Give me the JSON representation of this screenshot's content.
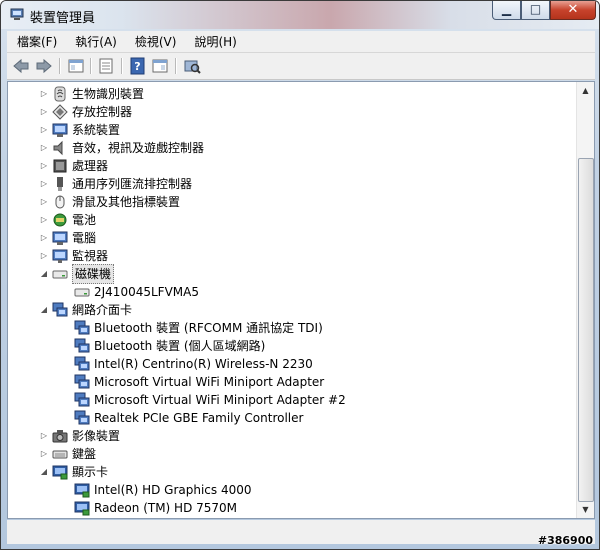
{
  "window": {
    "title": "裝置管理員"
  },
  "caption_buttons": {
    "minimize": "▁",
    "maximize": "□",
    "close": "✕"
  },
  "menu": [
    "檔案(F)",
    "執行(A)",
    "檢視(V)",
    "說明(H)"
  ],
  "toolbar": [
    "back-icon",
    "forward-icon",
    "properties-view-icon",
    "details-icon",
    "help-icon",
    "window-icon",
    "scan-hardware-icon"
  ],
  "tree": [
    {
      "label": "生物識別裝置",
      "icon": "fingerprint-icon",
      "expander": "▷",
      "level": 0
    },
    {
      "label": "存放控制器",
      "icon": "storage-controller-icon",
      "expander": "▷",
      "level": 0
    },
    {
      "label": "系統裝置",
      "icon": "computer-icon",
      "expander": "▷",
      "level": 0
    },
    {
      "label": "音效，視訊及遊戲控制器",
      "icon": "speaker-icon",
      "expander": "▷",
      "level": 0
    },
    {
      "label": "處理器",
      "icon": "processor-icon",
      "expander": "▷",
      "level": 0
    },
    {
      "label": "通用序列匯流排控制器",
      "icon": "usb-icon",
      "expander": "▷",
      "level": 0
    },
    {
      "label": "滑鼠及其他指標裝置",
      "icon": "mouse-icon",
      "expander": "▷",
      "level": 0
    },
    {
      "label": "電池",
      "icon": "battery-icon",
      "expander": "▷",
      "level": 0
    },
    {
      "label": "電腦",
      "icon": "computer-icon",
      "expander": "▷",
      "level": 0
    },
    {
      "label": "監視器",
      "icon": "monitor-icon",
      "expander": "▷",
      "level": 0
    },
    {
      "label": "磁碟機",
      "icon": "disk-drive-icon",
      "expander": "◢",
      "level": 0,
      "selected": true
    },
    {
      "label": "2J410045LFVMA5",
      "icon": "disk-drive-icon",
      "expander": "",
      "level": 1
    },
    {
      "label": "網路介面卡",
      "icon": "network-adapter-icon",
      "expander": "◢",
      "level": 0
    },
    {
      "label": "Bluetooth 裝置 (RFCOMM 通訊協定 TDI)",
      "icon": "network-adapter-icon",
      "expander": "",
      "level": 1
    },
    {
      "label": "Bluetooth 裝置 (個人區域網路)",
      "icon": "network-adapter-icon",
      "expander": "",
      "level": 1
    },
    {
      "label": "Intel(R) Centrino(R) Wireless-N 2230",
      "icon": "network-adapter-icon",
      "expander": "",
      "level": 1
    },
    {
      "label": "Microsoft Virtual WiFi Miniport Adapter",
      "icon": "network-adapter-icon",
      "expander": "",
      "level": 1
    },
    {
      "label": "Microsoft Virtual WiFi Miniport Adapter #2",
      "icon": "network-adapter-icon",
      "expander": "",
      "level": 1
    },
    {
      "label": "Realtek PCIe GBE Family Controller",
      "icon": "network-adapter-icon",
      "expander": "",
      "level": 1
    },
    {
      "label": "影像裝置",
      "icon": "camera-icon",
      "expander": "▷",
      "level": 0
    },
    {
      "label": "鍵盤",
      "icon": "keyboard-icon",
      "expander": "▷",
      "level": 0
    },
    {
      "label": "顯示卡",
      "icon": "display-adapter-icon",
      "expander": "◢",
      "level": 0
    },
    {
      "label": "Intel(R) HD Graphics 4000",
      "icon": "display-adapter-icon",
      "expander": "",
      "level": 1
    },
    {
      "label": "Radeon (TM)  HD 7570M",
      "icon": "display-adapter-icon",
      "expander": "",
      "level": 1
    }
  ],
  "scrollbar": {
    "up": "▲",
    "down": "▼",
    "scroll_fraction": 1.0
  },
  "watermark": "#386900"
}
